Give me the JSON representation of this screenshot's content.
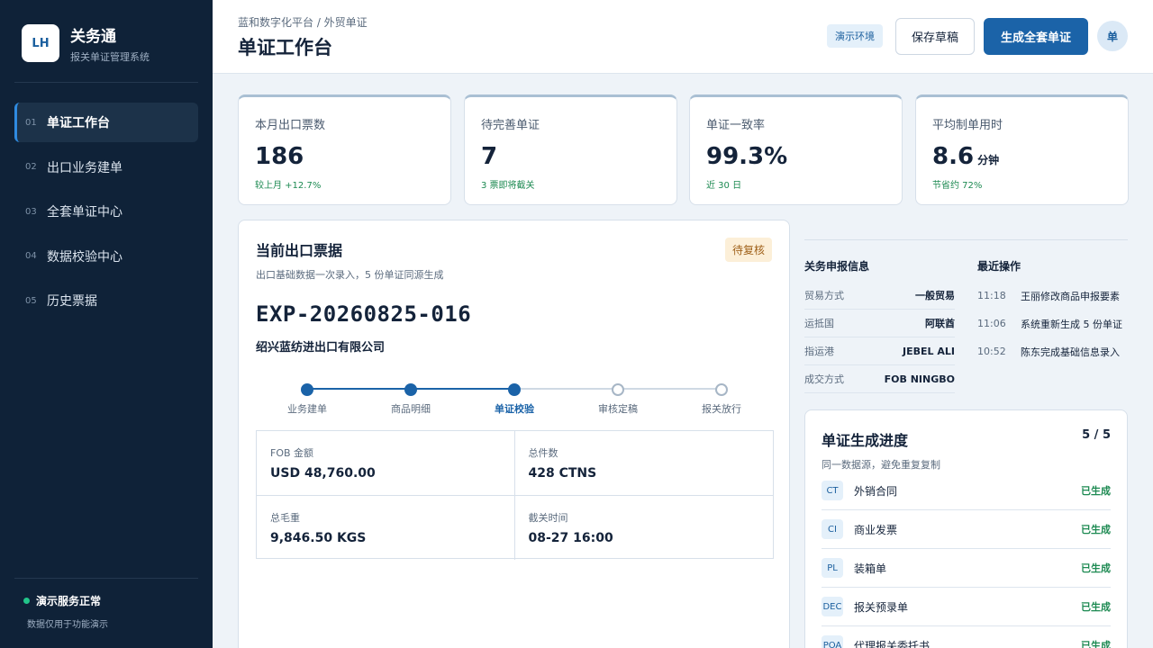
{
  "brand": {
    "logo": "LH",
    "name": "关务通",
    "sub": "报关单证管理系统"
  },
  "nav": [
    {
      "num": "01",
      "label": "单证工作台"
    },
    {
      "num": "02",
      "label": "出口业务建单"
    },
    {
      "num": "03",
      "label": "全套单证中心"
    },
    {
      "num": "04",
      "label": "数据校验中心"
    },
    {
      "num": "05",
      "label": "历史票据"
    }
  ],
  "footer": {
    "status": "演示服务正常",
    "note": "数据仅用于功能演示"
  },
  "header": {
    "breadcrumb": "蓝和数字化平台 / 外贸单证",
    "title": "单证工作台",
    "env": "演示环境",
    "save_label": "保存草稿",
    "generate_label": "生成全套单证",
    "avatar": "单"
  },
  "stats": [
    {
      "label": "本月出口票数",
      "value": "186",
      "unit": "",
      "note": "较上月 +12.7%"
    },
    {
      "label": "待完善单证",
      "value": "7",
      "unit": "",
      "note": "3 票即将截关"
    },
    {
      "label": "单证一致率",
      "value": "99.3%",
      "unit": "",
      "note": "近 30 日"
    },
    {
      "label": "平均制单用时",
      "value": "8.6",
      "unit": "分钟",
      "note": "节省约 72%"
    }
  ],
  "ticket": {
    "title": "当前出口票据",
    "subtitle": "出口基础数据一次录入，5 份单证同源生成",
    "badge": "待复核",
    "number": "EXP-20260825-016",
    "company": "绍兴蓝纺进出口有限公司",
    "steps": [
      "业务建单",
      "商品明细",
      "单证校验",
      "审核定稿",
      "报关放行"
    ],
    "current_step": 2,
    "fields": [
      {
        "label": "FOB 金额",
        "value": "USD 48,760.00"
      },
      {
        "label": "总件数",
        "value": "428 CTNS"
      },
      {
        "label": "总毛重",
        "value": "9,846.50 KGS"
      },
      {
        "label": "截关时间",
        "value": "08-27 16:00"
      }
    ]
  },
  "customs": {
    "title": "关务申报信息",
    "items": [
      {
        "k": "贸易方式",
        "v": "一般贸易"
      },
      {
        "k": "运抵国",
        "v": "阿联酋"
      },
      {
        "k": "指运港",
        "v": "JEBEL ALI"
      },
      {
        "k": "成交方式",
        "v": "FOB NINGBO"
      }
    ]
  },
  "recent": {
    "title": "最近操作",
    "items": [
      {
        "t": "11:18",
        "text": "王丽修改商品申报要素"
      },
      {
        "t": "11:06",
        "text": "系统重新生成 5 份单证"
      },
      {
        "t": "10:52",
        "text": "陈东完成基础信息录入"
      }
    ]
  },
  "progress": {
    "title": "单证生成进度",
    "count": "5 / 5",
    "subtitle": "同一数据源，避免重复复制",
    "docs": [
      {
        "code": "CT",
        "name": "外销合同",
        "status": "已生成"
      },
      {
        "code": "CI",
        "name": "商业发票",
        "status": "已生成"
      },
      {
        "code": "PL",
        "name": "装箱单",
        "status": "已生成"
      },
      {
        "code": "DEC",
        "name": "报关预录单",
        "status": "已生成"
      },
      {
        "code": "POA",
        "name": "代理报关委托书",
        "status": "已生成"
      }
    ]
  },
  "colors": {
    "accent": "#1b63a8",
    "sidebar": "#0f2238",
    "success": "#1d8a52",
    "warning": "#a0621b"
  }
}
